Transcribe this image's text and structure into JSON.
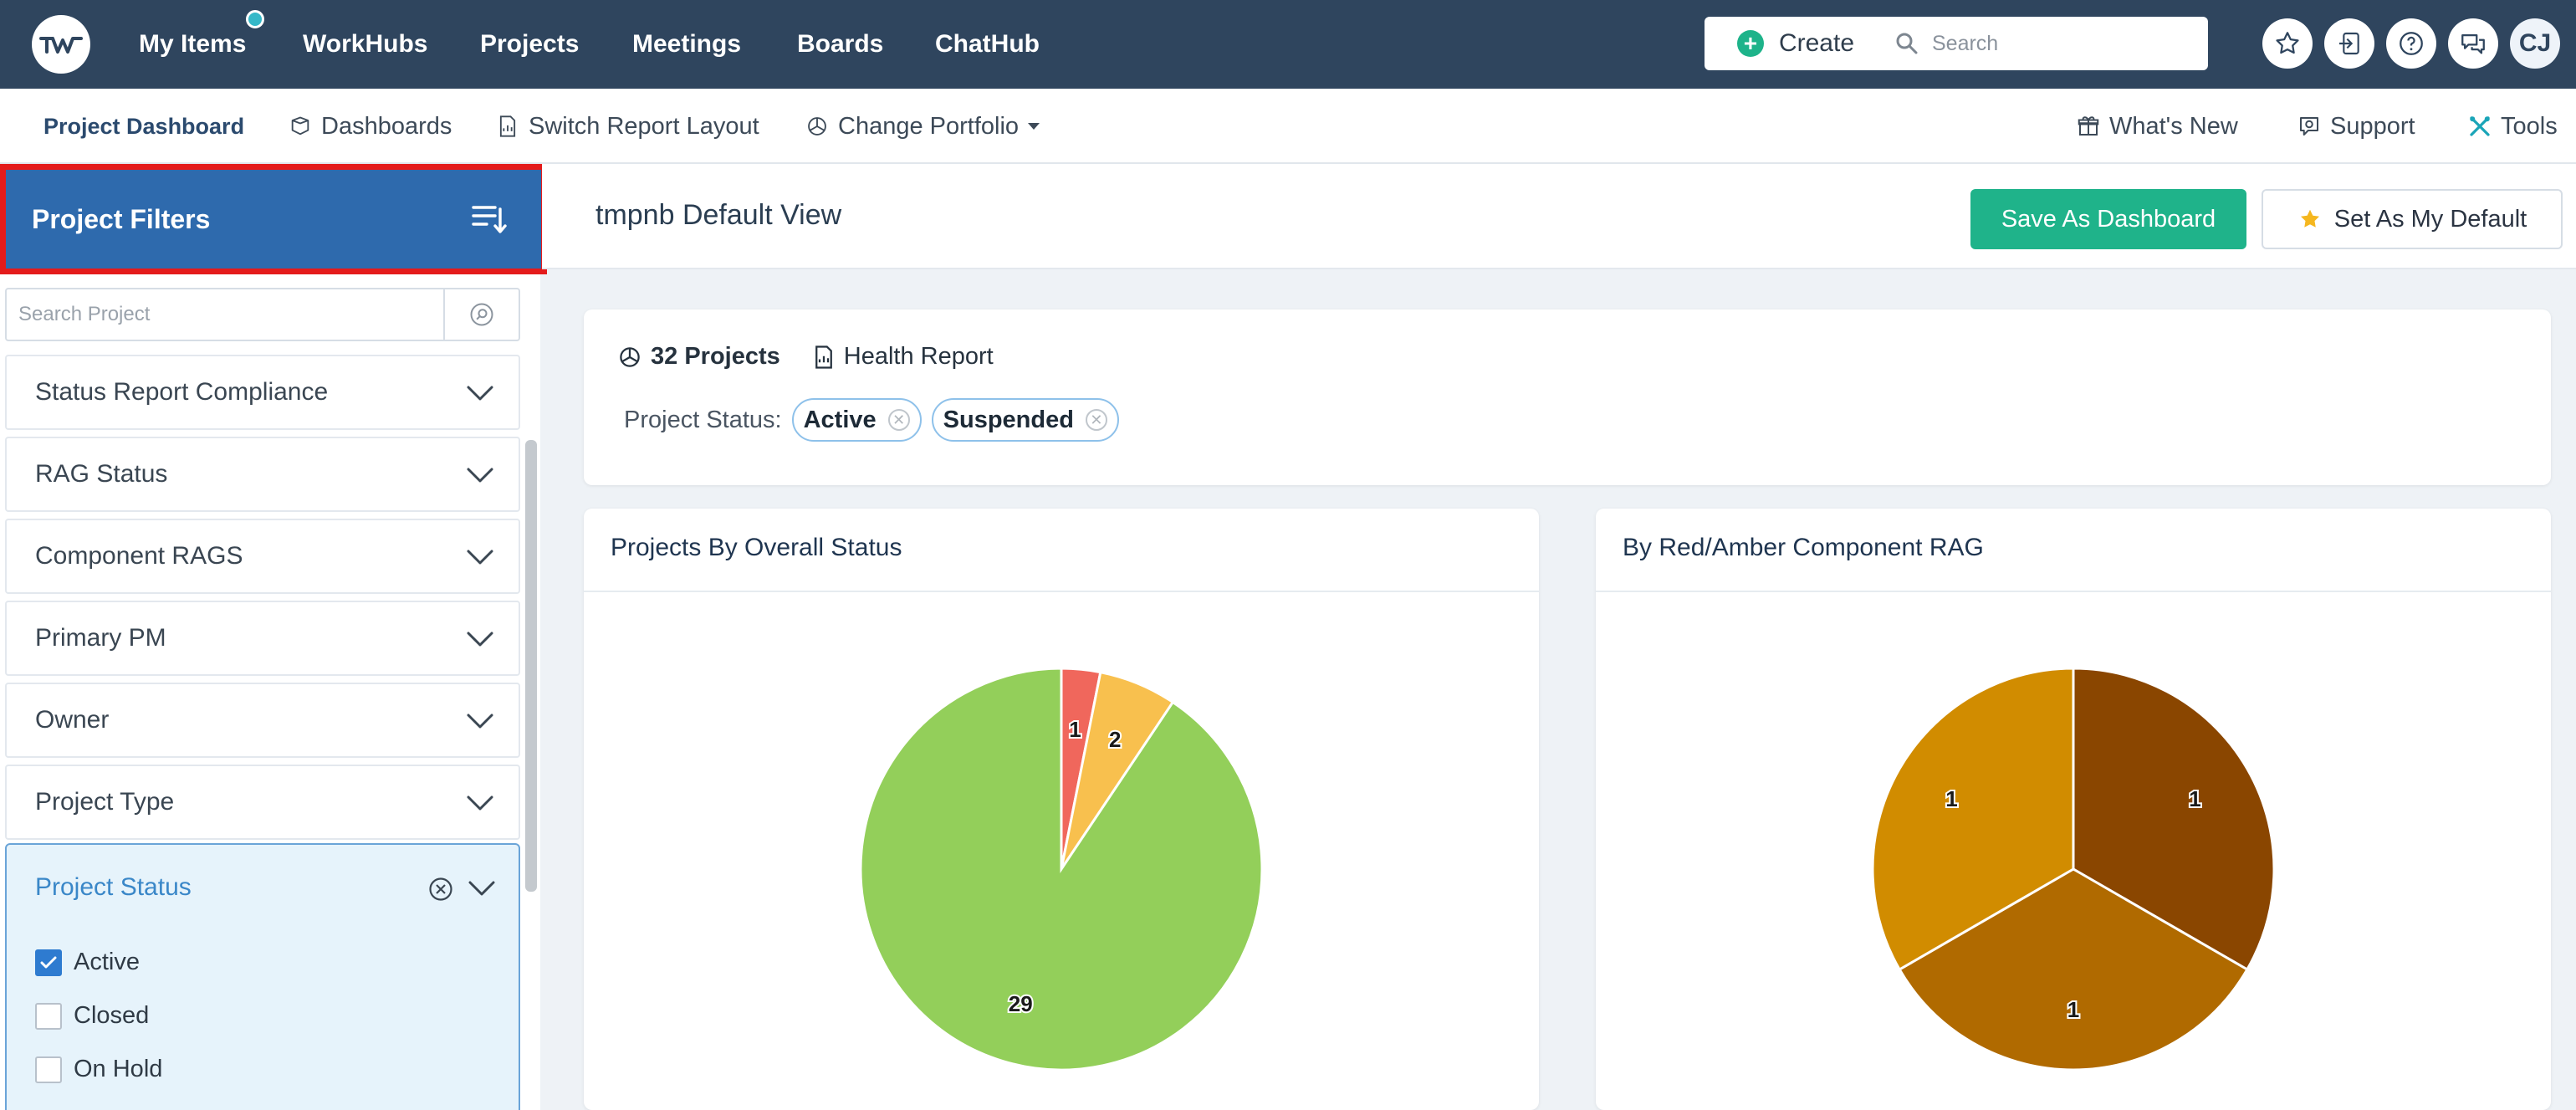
{
  "topnav": {
    "items": [
      "My Items",
      "WorkHubs",
      "Projects",
      "Meetings",
      "Boards",
      "ChatHub"
    ],
    "create_label": "Create",
    "search_placeholder": "Search",
    "avatar_initials": "CJ"
  },
  "subnav": {
    "left": [
      "Project Dashboard",
      "Dashboards",
      "Switch Report Layout",
      "Change Portfolio"
    ],
    "right": [
      "What's New",
      "Support",
      "Tools"
    ]
  },
  "sidebar": {
    "header": "Project Filters",
    "search_placeholder": "Search Project",
    "filters": [
      "Status Report Compliance",
      "RAG Status",
      "Component RAGS",
      "Primary PM",
      "Owner",
      "Project Type"
    ],
    "status_panel": {
      "title": "Project Status",
      "options": [
        {
          "label": "Active",
          "checked": true
        },
        {
          "label": "Closed",
          "checked": false
        },
        {
          "label": "On Hold",
          "checked": false
        }
      ]
    }
  },
  "main": {
    "view_title": "tmpnb Default View",
    "save_dashboard_label": "Save As Dashboard",
    "set_default_label": "Set As My Default",
    "summary": {
      "project_count": "32 Projects",
      "health_report": "Health Report",
      "status_label": "Project Status:",
      "chips": [
        "Active",
        "Suspended"
      ]
    }
  },
  "colors": {
    "nav_bg": "#2f455e",
    "accent_green": "#1fb38a",
    "filter_header": "#2e6aad"
  },
  "chart_data": [
    {
      "type": "pie",
      "title": "Projects By Overall Status",
      "values": [
        1,
        2,
        29
      ],
      "colors": [
        "#f0675c",
        "#f8c04e",
        "#93cf5a"
      ]
    },
    {
      "type": "pie",
      "title": "By Red/Amber Component RAG",
      "values": [
        1,
        1,
        1
      ],
      "colors": [
        "#8a4600",
        "#b06a00",
        "#d18c00"
      ]
    }
  ]
}
